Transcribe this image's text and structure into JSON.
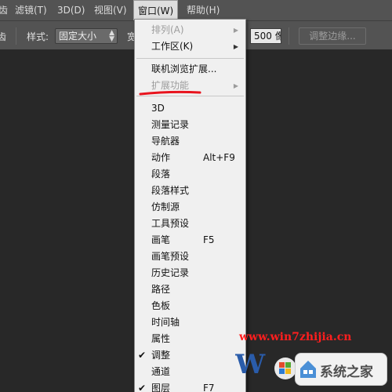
{
  "menubar": {
    "items": [
      {
        "label": "齿"
      },
      {
        "label": "滤镜(T)"
      },
      {
        "label": "3D(D)"
      },
      {
        "label": "视图(V)"
      },
      {
        "label": "窗口(W)"
      },
      {
        "label": "帮助(H)"
      }
    ]
  },
  "options": {
    "clipped_left": "齿",
    "style_label": "样式:",
    "style_value": "固定大小",
    "clipped_width": "宽",
    "height_value": "500 像",
    "refine_edge": "调整边缘..."
  },
  "menu": {
    "items": [
      {
        "label": "排列(A)",
        "disabled": true,
        "submenu": true
      },
      {
        "label": "工作区(K)",
        "disabled": false,
        "submenu": true
      },
      {
        "label": "联机浏览扩展...",
        "disabled": false
      },
      {
        "label": "扩展功能",
        "disabled": true,
        "submenu": true
      },
      {
        "label": "3D"
      },
      {
        "label": "测量记录"
      },
      {
        "label": "导航器"
      },
      {
        "label": "动作",
        "shortcut": "Alt+F9"
      },
      {
        "label": "段落"
      },
      {
        "label": "段落样式"
      },
      {
        "label": "仿制源"
      },
      {
        "label": "工具预设"
      },
      {
        "label": "画笔",
        "shortcut": "F5"
      },
      {
        "label": "画笔预设"
      },
      {
        "label": "历史记录"
      },
      {
        "label": "路径"
      },
      {
        "label": "色板"
      },
      {
        "label": "时间轴"
      },
      {
        "label": "属性"
      },
      {
        "label": "调整",
        "checked": true
      },
      {
        "label": "通道"
      },
      {
        "label": "图层",
        "shortcut": "F7",
        "checked": true
      }
    ]
  },
  "watermark": {
    "url": "www.win7zhijia.cn",
    "badge": "系统之家"
  },
  "colors": {
    "highlight": "#e8141e",
    "menu_bg": "#f0f0f0",
    "bar_bg": "#535353"
  }
}
